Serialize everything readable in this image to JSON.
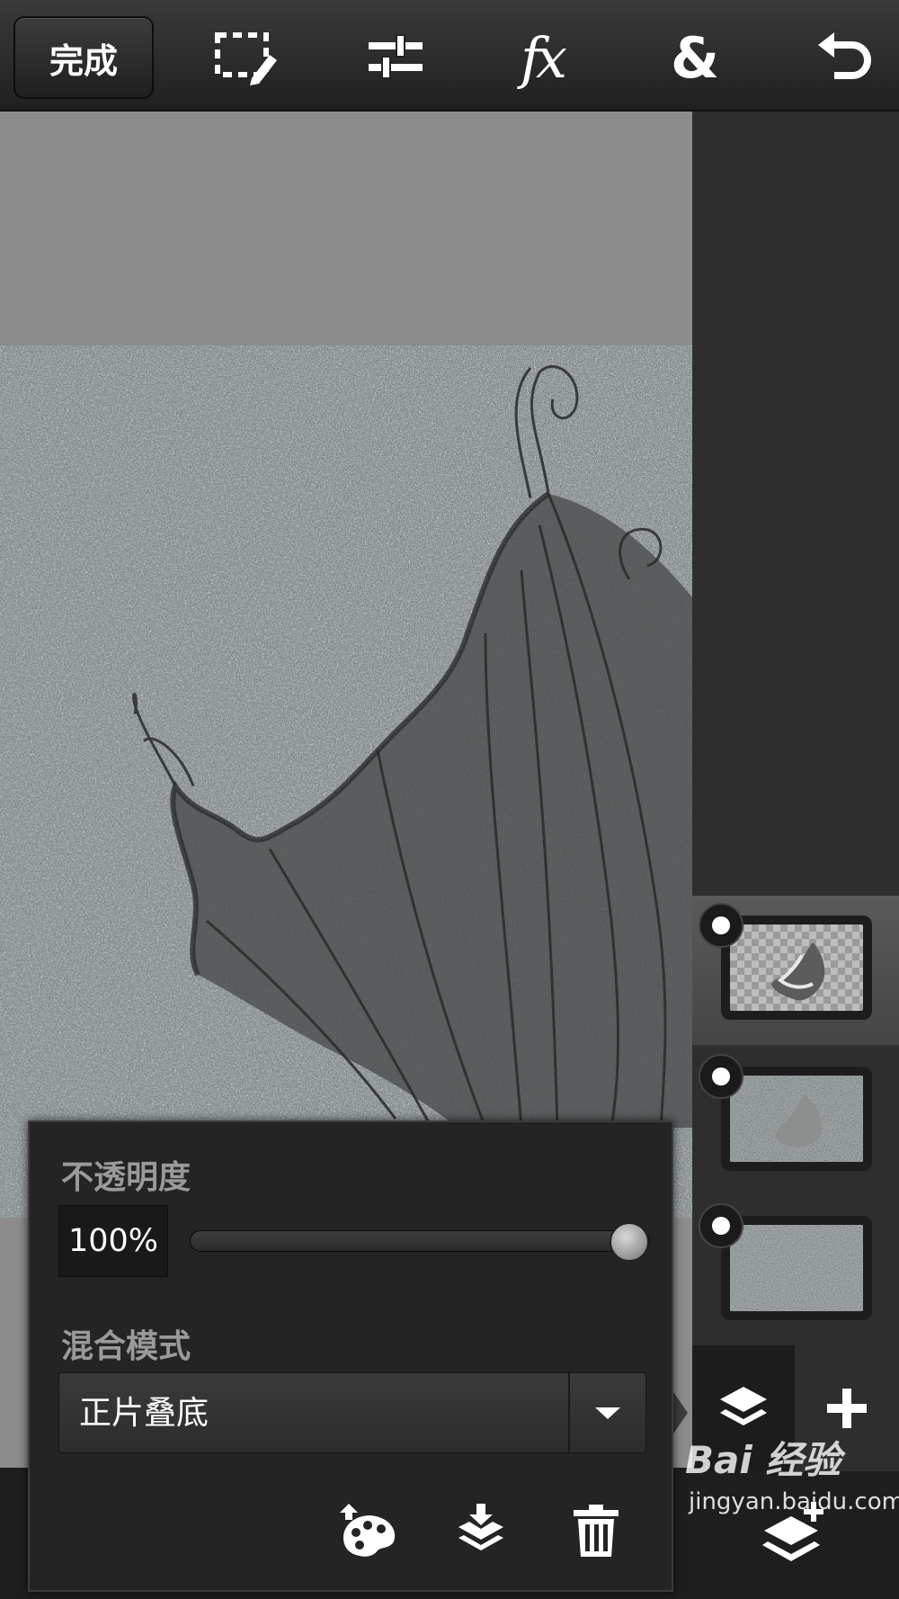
{
  "toolbar": {
    "done_label": "完成",
    "icons": [
      "selection-edit-icon",
      "adjustments-icon",
      "fx-icon",
      "blend-ampersand-icon",
      "undo-icon"
    ]
  },
  "layers": [
    {
      "name": "wing-layer",
      "selected": true,
      "visible": true
    },
    {
      "name": "shape-layer",
      "selected": false,
      "visible": true
    },
    {
      "name": "background-layer",
      "selected": false,
      "visible": true
    }
  ],
  "layer_properties": {
    "opacity_label": "不透明度",
    "opacity_value": "100%",
    "opacity_fraction": 1.0,
    "blend_label": "混合模式",
    "blend_value": "正片叠底",
    "actions": [
      "color-layer-icon",
      "merge-down-icon",
      "delete-icon"
    ]
  },
  "watermark": {
    "logo": "Bai 经验",
    "url": "jingyan.baidu.com"
  },
  "colors": {
    "toolbar_bg": "#2a2a2a",
    "canvas_bg": "#8c8c8c",
    "panel_bg": "#242424",
    "accent_white": "#ffffff"
  }
}
